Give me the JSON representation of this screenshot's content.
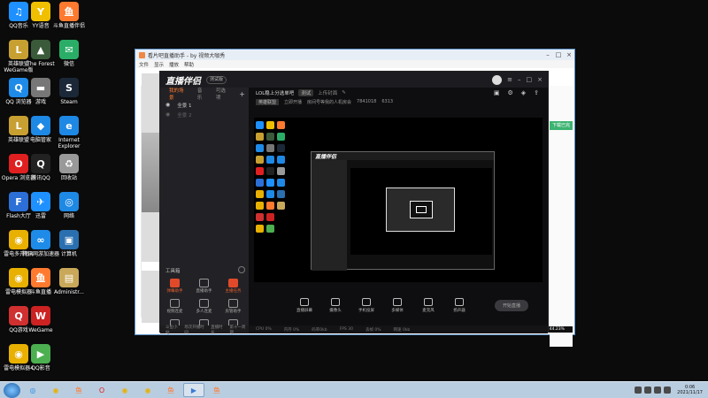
{
  "desktop": {
    "col1": [
      {
        "label": "QQ音乐",
        "glyph": "♫",
        "color": "#1e90ff"
      },
      {
        "label": "英雄联盟 WeGame版",
        "glyph": "L",
        "color": "#c8a032"
      },
      {
        "label": "QQ 浏览器",
        "glyph": "Q",
        "color": "#1e8be8"
      },
      {
        "label": "英雄联盟",
        "glyph": "L",
        "color": "#c8a032"
      },
      {
        "label": "Opera 浏览器",
        "glyph": "O",
        "color": "#e02020"
      },
      {
        "label": "Flash大厅",
        "glyph": "F",
        "color": "#2c6fd6"
      },
      {
        "label": "雷电多开器4",
        "glyph": "◉",
        "color": "#e8b000"
      },
      {
        "label": "雷电模拟器",
        "glyph": "◉",
        "color": "#e8b000"
      },
      {
        "label": "QQ游戏",
        "glyph": "Q",
        "color": "#d03030"
      },
      {
        "label": "雷电模拟器4",
        "glyph": "◉",
        "color": "#e8b000"
      }
    ],
    "col2": [
      {
        "label": "YY语音",
        "glyph": "Y",
        "color": "#f0c000"
      },
      {
        "label": "The Forest",
        "glyph": "▲",
        "color": "#3a5a3a"
      },
      {
        "label": "游戏",
        "glyph": "▬",
        "color": "#777777"
      },
      {
        "label": "电脑管家",
        "glyph": "◆",
        "color": "#1e88e5"
      },
      {
        "label": "腾讯QQ",
        "glyph": "Q",
        "color": "#222222"
      },
      {
        "label": "迅雷",
        "glyph": "✈",
        "color": "#1e90ff"
      },
      {
        "label": "腾讯网游加速器",
        "glyph": "∞",
        "color": "#1e8be8"
      },
      {
        "label": "斗鱼直播",
        "glyph": "鱼",
        "color": "#ff7a2e"
      },
      {
        "label": "WeGame",
        "glyph": "W",
        "color": "#cc2222"
      },
      {
        "label": "QQ影音",
        "glyph": "▶",
        "color": "#4caf50"
      }
    ],
    "col3": [
      {
        "label": "斗鱼直播伴侣",
        "glyph": "鱼",
        "color": "#ff7a2e"
      },
      {
        "label": "微信",
        "glyph": "✉",
        "color": "#2aae67"
      },
      {
        "label": "Steam",
        "glyph": "S",
        "color": "#1b2838"
      },
      {
        "label": "Internet Explorer",
        "glyph": "e",
        "color": "#1e88e5"
      },
      {
        "label": "回收站",
        "glyph": "♻",
        "color": "#999999"
      },
      {
        "label": "网络",
        "glyph": "◎",
        "color": "#1e88e5"
      },
      {
        "label": "计算机",
        "glyph": "▣",
        "color": "#2a6fb0"
      },
      {
        "label": "Administr...",
        "glyph": "▤",
        "color": "#c9a85a"
      }
    ]
  },
  "window": {
    "title": "看片吧直播助手 - by 视频大咖秀",
    "menu": [
      "文件",
      "显示",
      "播放",
      "帮助"
    ],
    "side_button": "下载已完",
    "status": "片段缓冲进度0.42% 视频总进度：44.23%"
  },
  "app": {
    "logo": "直播伴侣",
    "badge": "测试版",
    "tabs": [
      "我的场景",
      "音乐",
      "可选项"
    ],
    "scenes": [
      "全景 1",
      "全景 2"
    ],
    "room_title": "LOL稳上分选单吧",
    "room_tag": "测试",
    "room_action": "上传封面",
    "category": "英雄联盟",
    "category_action": "立即开播",
    "room_info": "房间号等我的人机房会",
    "room_id": "7841018",
    "fans": "6313",
    "tools_title": "工具箱",
    "tools": [
      {
        "label": "弹幕助手",
        "hot": true
      },
      {
        "label": "直播助手",
        "hot": false
      },
      {
        "label": "主播任务",
        "hot": true
      },
      {
        "label": "视频连麦",
        "hot": false
      },
      {
        "label": "多人连麦",
        "hot": false
      },
      {
        "label": "房管助手",
        "hot": false
      },
      {
        "label": "虚拟形象",
        "hot": false
      },
      {
        "label": "弹幕库",
        "hot": false
      },
      {
        "label": "歌词助手",
        "hot": false
      }
    ],
    "bottom_buttons": [
      "直播屏幕",
      "摄像头",
      "手机投屏",
      "多媒体",
      "麦克风",
      "扬声器"
    ],
    "live_button": "开始直播",
    "footer": [
      "斗鱼小站",
      "场次开播时间",
      "直播时长",
      "第十一周期"
    ],
    "stats": [
      "CPU 0%",
      "内存 0%",
      "码率0kb",
      "FPS 30",
      "丢帧 0%",
      "网速 0kb"
    ]
  },
  "taskbar": {
    "items": [
      {
        "glyph": "◎",
        "color": "#1e88e5",
        "active": false
      },
      {
        "glyph": "◉",
        "color": "#e8b000",
        "active": false
      },
      {
        "glyph": "鱼",
        "color": "#ff7a2e",
        "active": false
      },
      {
        "glyph": "O",
        "color": "#e02020",
        "active": false
      },
      {
        "glyph": "◉",
        "color": "#e8b000",
        "active": false
      },
      {
        "glyph": "◉",
        "color": "#e8b000",
        "active": false
      },
      {
        "glyph": "鱼",
        "color": "#ff7a2e",
        "active": false
      },
      {
        "glyph": "▶",
        "color": "#3a7bd5",
        "active": true
      },
      {
        "glyph": "鱼",
        "color": "#ff7a2e",
        "active": false
      }
    ],
    "time": "0:06",
    "date": "2021/11/17"
  },
  "colors": {
    "accent": "#ff7a2e",
    "hot": "#e04a2a",
    "window_border": "#5a8fc6"
  }
}
